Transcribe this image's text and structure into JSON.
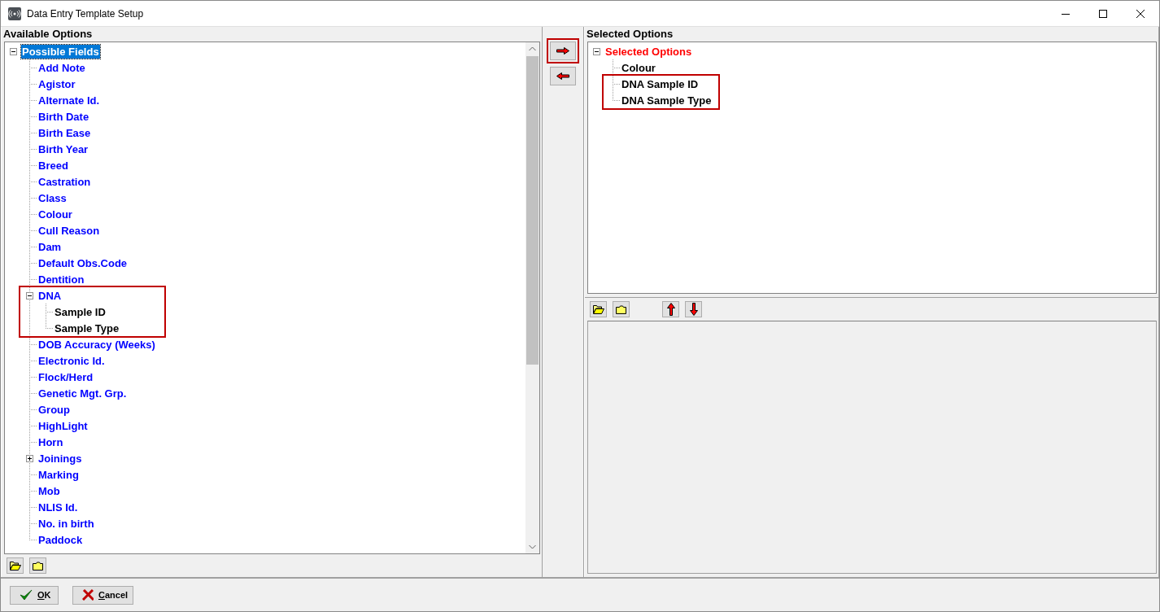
{
  "window": {
    "title": "Data Entry Template Setup"
  },
  "available": {
    "heading": "Available Options",
    "tree": {
      "label": "Possible Fields",
      "selected": true,
      "expanded": true,
      "children": [
        {
          "label": "Add Note"
        },
        {
          "label": "Agistor"
        },
        {
          "label": "Alternate Id."
        },
        {
          "label": "Birth Date"
        },
        {
          "label": "Birth Ease"
        },
        {
          "label": "Birth Year"
        },
        {
          "label": "Breed"
        },
        {
          "label": "Castration"
        },
        {
          "label": "Class"
        },
        {
          "label": "Colour"
        },
        {
          "label": "Cull Reason"
        },
        {
          "label": "Dam"
        },
        {
          "label": "Default Obs.Code"
        },
        {
          "label": "Dentition"
        },
        {
          "label": "DNA",
          "expanded": true,
          "highlighted": true,
          "children": [
            {
              "label": "Sample ID"
            },
            {
              "label": "Sample Type"
            }
          ]
        },
        {
          "label": "DOB Accuracy (Weeks)"
        },
        {
          "label": "Electronic Id."
        },
        {
          "label": "Flock/Herd"
        },
        {
          "label": "Genetic Mgt. Grp."
        },
        {
          "label": "Group"
        },
        {
          "label": "HighLight"
        },
        {
          "label": "Horn"
        },
        {
          "label": "Joinings",
          "expanded": false
        },
        {
          "label": "Marking"
        },
        {
          "label": "Mob"
        },
        {
          "label": "NLIS Id."
        },
        {
          "label": "No. in birth"
        },
        {
          "label": "Paddock"
        }
      ]
    }
  },
  "transfer_buttons": [
    {
      "kind": "add",
      "highlighted": true
    },
    {
      "kind": "remove",
      "highlighted": false
    }
  ],
  "selected": {
    "heading": "Selected Options",
    "tree": {
      "label": "Selected Options",
      "selected": false,
      "expanded": true,
      "children": [
        {
          "label": "Colour",
          "highlighted": false
        },
        {
          "label": "DNA Sample ID",
          "highlighted": true
        },
        {
          "label": "DNA Sample Type",
          "highlighted": true
        }
      ]
    }
  },
  "footer": {
    "buttons": [
      {
        "kind": "ok",
        "label": "OK"
      },
      {
        "kind": "cancel",
        "label": "Cancel"
      }
    ]
  }
}
